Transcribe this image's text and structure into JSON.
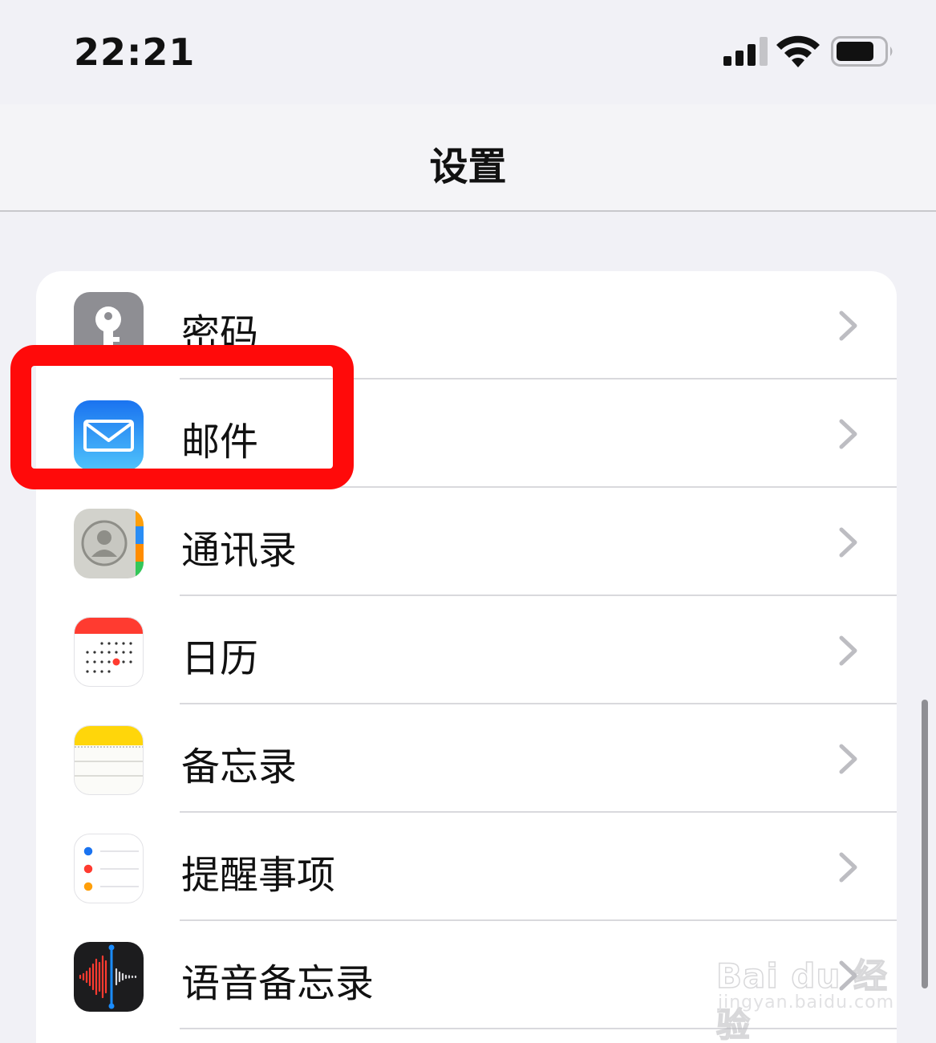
{
  "status_bar": {
    "time": "22:21",
    "signal_icon": "cellular-signal-icon",
    "wifi_icon": "wifi-icon",
    "battery_icon": "battery-icon",
    "battery_level": 0.8
  },
  "nav": {
    "title": "设置"
  },
  "settings_list": {
    "items": [
      {
        "label": "密码",
        "icon": "key-icon",
        "icon_color": "#8e8e93"
      },
      {
        "label": "邮件",
        "icon": "mail-envelope-icon",
        "icon_color": "#1b8cf6"
      },
      {
        "label": "通讯录",
        "icon": "contacts-icon",
        "icon_color": "#c9c9c4"
      },
      {
        "label": "日历",
        "icon": "calendar-icon",
        "icon_color": "#ff3b30"
      },
      {
        "label": "备忘录",
        "icon": "notes-icon",
        "icon_color": "#ffd60a"
      },
      {
        "label": "提醒事项",
        "icon": "reminders-icon",
        "icon_color": "#ffffff"
      },
      {
        "label": "语音备忘录",
        "icon": "voice-memos-icon",
        "icon_color": "#1c1c1e"
      }
    ]
  },
  "annotation": {
    "highlight_color": "#ff0a0a"
  },
  "watermark": {
    "main": "Bai du 经验",
    "sub": "jingyan.baidu.com"
  }
}
